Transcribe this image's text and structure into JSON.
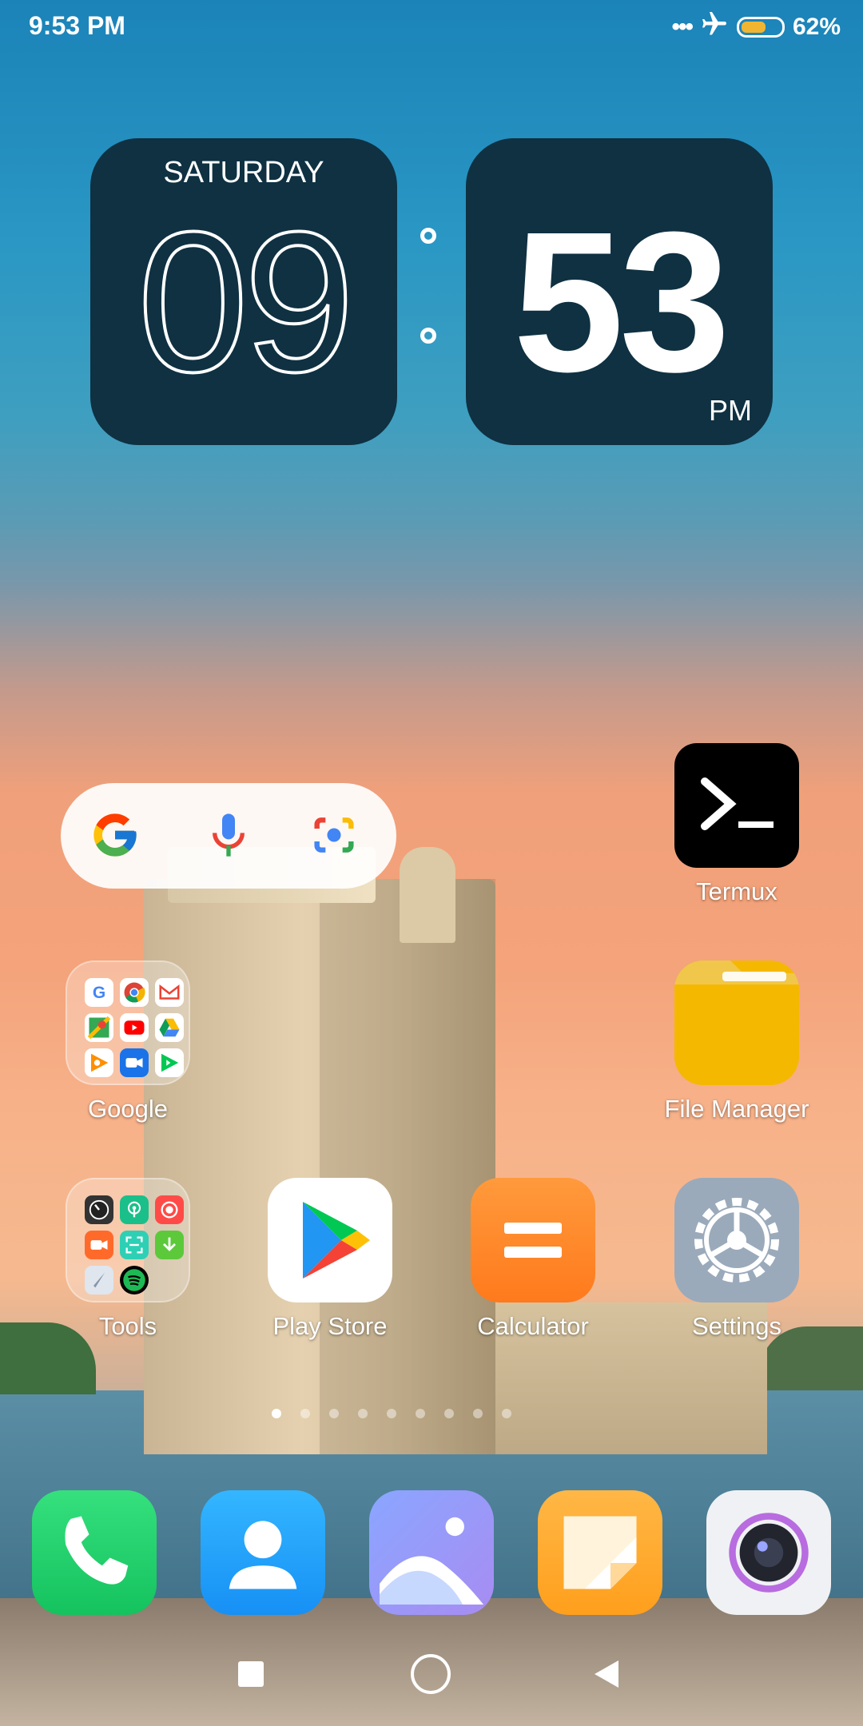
{
  "status_bar": {
    "time": "9:53 PM",
    "battery_text": "62%",
    "battery_level": 0.62,
    "icons": [
      "more-dots-icon",
      "airplane-mode-icon",
      "battery-icon"
    ]
  },
  "clock_widget": {
    "day": "SATURDAY",
    "hours": "09",
    "minutes": "53",
    "ampm": "PM"
  },
  "search_widget": {
    "icons": [
      "google-g-icon",
      "microphone-icon",
      "lens-camera-icon"
    ]
  },
  "apps": {
    "termux": {
      "label": "Termux",
      "icon": "terminal-icon"
    },
    "google_folder": {
      "label": "Google",
      "items": [
        "google-icon",
        "chrome-icon",
        "gmail-icon",
        "maps-icon",
        "youtube-icon",
        "drive-icon",
        "play-music-icon",
        "duo-icon",
        "play-movies-icon"
      ]
    },
    "file_manager": {
      "label": "File Manager",
      "icon": "folder-icon"
    },
    "tools_folder": {
      "label": "Tools",
      "items": [
        "clock-icon",
        "radio-icon",
        "recorder-icon",
        "screen-recorder-icon",
        "scanner-icon",
        "downloads-icon",
        "compass-icon",
        "spotify-icon"
      ]
    },
    "play_store": {
      "label": "Play Store",
      "icon": "play-store-icon"
    },
    "calculator": {
      "label": "Calculator",
      "icon": "calculator-icon"
    },
    "settings": {
      "label": "Settings",
      "icon": "gear-icon"
    }
  },
  "page_indicator": {
    "count": 9,
    "active": 0
  },
  "dock": [
    "phone-icon",
    "contacts-icon",
    "gallery-icon",
    "notes-icon",
    "camera-icon"
  ],
  "navbar": [
    "recents-square-icon",
    "home-circle-icon",
    "back-triangle-icon"
  ],
  "colors": {
    "clock_bg": "#0f3142",
    "battery_fill": "#f2b531",
    "phone": "#1fd46f",
    "contacts": "#1ea6ff",
    "calculator": "#ff8a2a",
    "file_manager": "#f5b800"
  }
}
